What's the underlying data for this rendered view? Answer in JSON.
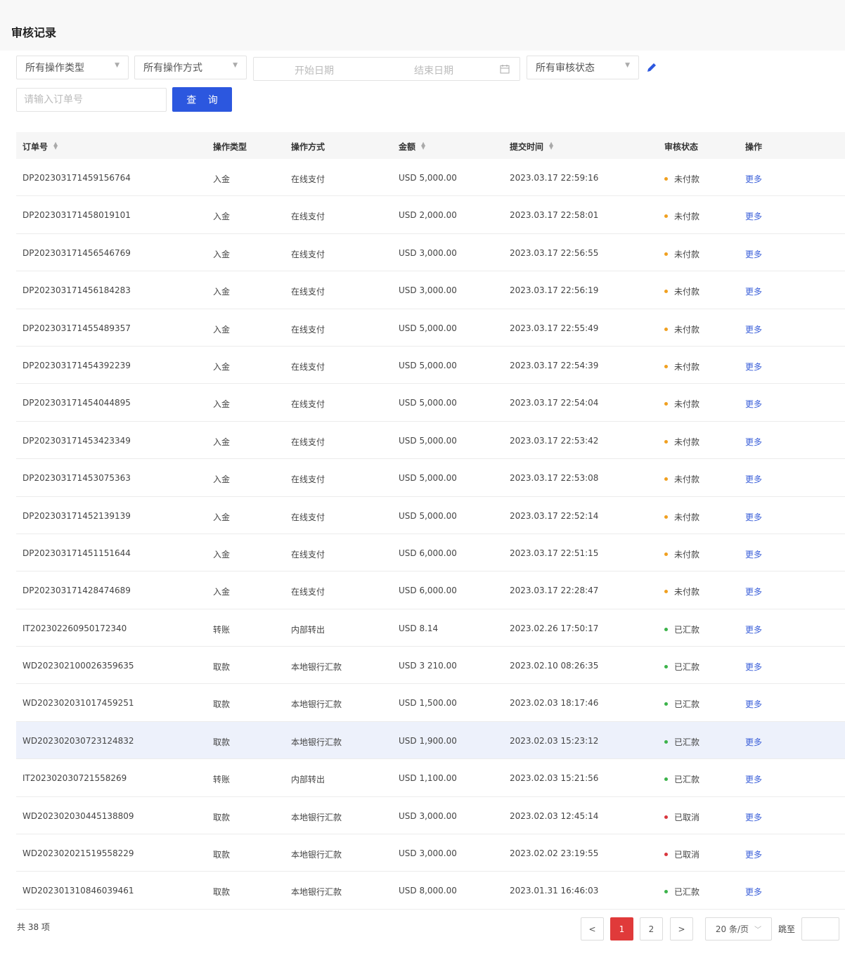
{
  "page": {
    "title": "审核记录"
  },
  "filters": {
    "operation_type": "所有操作类型",
    "operation_method": "所有操作方式",
    "start_date_placeholder": "开始日期",
    "end_date_placeholder": "结束日期",
    "review_status": "所有审核状态",
    "order_placeholder": "请输入订单号",
    "search_label": "查 询"
  },
  "table": {
    "headers": {
      "order_no": "订单号",
      "op_type": "操作类型",
      "op_method": "操作方式",
      "amount": "金额",
      "submit_time": "提交时间",
      "status": "审核状态",
      "action": "操作"
    },
    "rows": [
      {
        "order": "DP202303171459156764",
        "type": "入金",
        "method": "在线支付",
        "amount": "USD 5,000.00",
        "time": "2023.03.17 22:59:16",
        "status": "未付款",
        "status_color": "#f0a020",
        "action": "更多"
      },
      {
        "order": "DP202303171458019101",
        "type": "入金",
        "method": "在线支付",
        "amount": "USD 2,000.00",
        "time": "2023.03.17 22:58:01",
        "status": "未付款",
        "status_color": "#f0a020",
        "action": "更多"
      },
      {
        "order": "DP202303171456546769",
        "type": "入金",
        "method": "在线支付",
        "amount": "USD 3,000.00",
        "time": "2023.03.17 22:56:55",
        "status": "未付款",
        "status_color": "#f0a020",
        "action": "更多"
      },
      {
        "order": "DP202303171456184283",
        "type": "入金",
        "method": "在线支付",
        "amount": "USD 3,000.00",
        "time": "2023.03.17 22:56:19",
        "status": "未付款",
        "status_color": "#f0a020",
        "action": "更多"
      },
      {
        "order": "DP202303171455489357",
        "type": "入金",
        "method": "在线支付",
        "amount": "USD 5,000.00",
        "time": "2023.03.17 22:55:49",
        "status": "未付款",
        "status_color": "#f0a020",
        "action": "更多"
      },
      {
        "order": "DP202303171454392239",
        "type": "入金",
        "method": "在线支付",
        "amount": "USD 5,000.00",
        "time": "2023.03.17 22:54:39",
        "status": "未付款",
        "status_color": "#f0a020",
        "action": "更多"
      },
      {
        "order": "DP202303171454044895",
        "type": "入金",
        "method": "在线支付",
        "amount": "USD 5,000.00",
        "time": "2023.03.17 22:54:04",
        "status": "未付款",
        "status_color": "#f0a020",
        "action": "更多"
      },
      {
        "order": "DP202303171453423349",
        "type": "入金",
        "method": "在线支付",
        "amount": "USD 5,000.00",
        "time": "2023.03.17 22:53:42",
        "status": "未付款",
        "status_color": "#f0a020",
        "action": "更多"
      },
      {
        "order": "DP202303171453075363",
        "type": "入金",
        "method": "在线支付",
        "amount": "USD 5,000.00",
        "time": "2023.03.17 22:53:08",
        "status": "未付款",
        "status_color": "#f0a020",
        "action": "更多"
      },
      {
        "order": "DP202303171452139139",
        "type": "入金",
        "method": "在线支付",
        "amount": "USD 5,000.00",
        "time": "2023.03.17 22:52:14",
        "status": "未付款",
        "status_color": "#f0a020",
        "action": "更多"
      },
      {
        "order": "DP202303171451151644",
        "type": "入金",
        "method": "在线支付",
        "amount": "USD 6,000.00",
        "time": "2023.03.17 22:51:15",
        "status": "未付款",
        "status_color": "#f0a020",
        "action": "更多"
      },
      {
        "order": "DP202303171428474689",
        "type": "入金",
        "method": "在线支付",
        "amount": "USD 6,000.00",
        "time": "2023.03.17 22:28:47",
        "status": "未付款",
        "status_color": "#f0a020",
        "action": "更多"
      },
      {
        "order": "IT202302260950172340",
        "type": "转账",
        "method": "内部转出",
        "amount": "USD 8.14",
        "time": "2023.02.26 17:50:17",
        "status": "已汇款",
        "status_color": "#3cb34a",
        "action": "更多"
      },
      {
        "order": "WD202302100026359635",
        "type": "取款",
        "method": "本地银行汇款",
        "amount": "USD 3 210.00",
        "time": "2023.02.10 08:26:35",
        "status": "已汇款",
        "status_color": "#3cb34a",
        "action": "更多"
      },
      {
        "order": "WD202302031017459251",
        "type": "取款",
        "method": "本地银行汇款",
        "amount": "USD 1,500.00",
        "time": "2023.02.03 18:17:46",
        "status": "已汇款",
        "status_color": "#3cb34a",
        "action": "更多"
      },
      {
        "order": "WD202302030723124832",
        "type": "取款",
        "method": "本地银行汇款",
        "amount": "USD 1,900.00",
        "time": "2023.02.03 15:23:12",
        "status": "已汇款",
        "status_color": "#3cb34a",
        "action": "更多"
      },
      {
        "order": "IT202302030721558269",
        "type": "转账",
        "method": "内部转出",
        "amount": "USD 1,100.00",
        "time": "2023.02.03 15:21:56",
        "status": "已汇款",
        "status_color": "#3cb34a",
        "action": "更多"
      },
      {
        "order": "WD202302030445138809",
        "type": "取款",
        "method": "本地银行汇款",
        "amount": "USD 3,000.00",
        "time": "2023.02.03 12:45:14",
        "status": "已取消",
        "status_color": "#d9363e",
        "action": "更多"
      },
      {
        "order": "WD202302021519558229",
        "type": "取款",
        "method": "本地银行汇款",
        "amount": "USD 3,000.00",
        "time": "2023.02.02 23:19:55",
        "status": "已取消",
        "status_color": "#d9363e",
        "action": "更多"
      },
      {
        "order": "WD202301310846039461",
        "type": "取款",
        "method": "本地银行汇款",
        "amount": "USD 8,000.00",
        "time": "2023.01.31 16:46:03",
        "status": "已汇款",
        "status_color": "#3cb34a",
        "action": "更多"
      }
    ]
  },
  "pagination": {
    "total": "共 38 项",
    "prev": "<",
    "pages": [
      "1",
      "2"
    ],
    "current": "1",
    "next": ">",
    "page_size": "20 条/页",
    "jump_label": "跳至"
  },
  "colors": {
    "accent": "#2c57df",
    "link": "#3a5fd9",
    "active_page": "#e03a3a"
  }
}
